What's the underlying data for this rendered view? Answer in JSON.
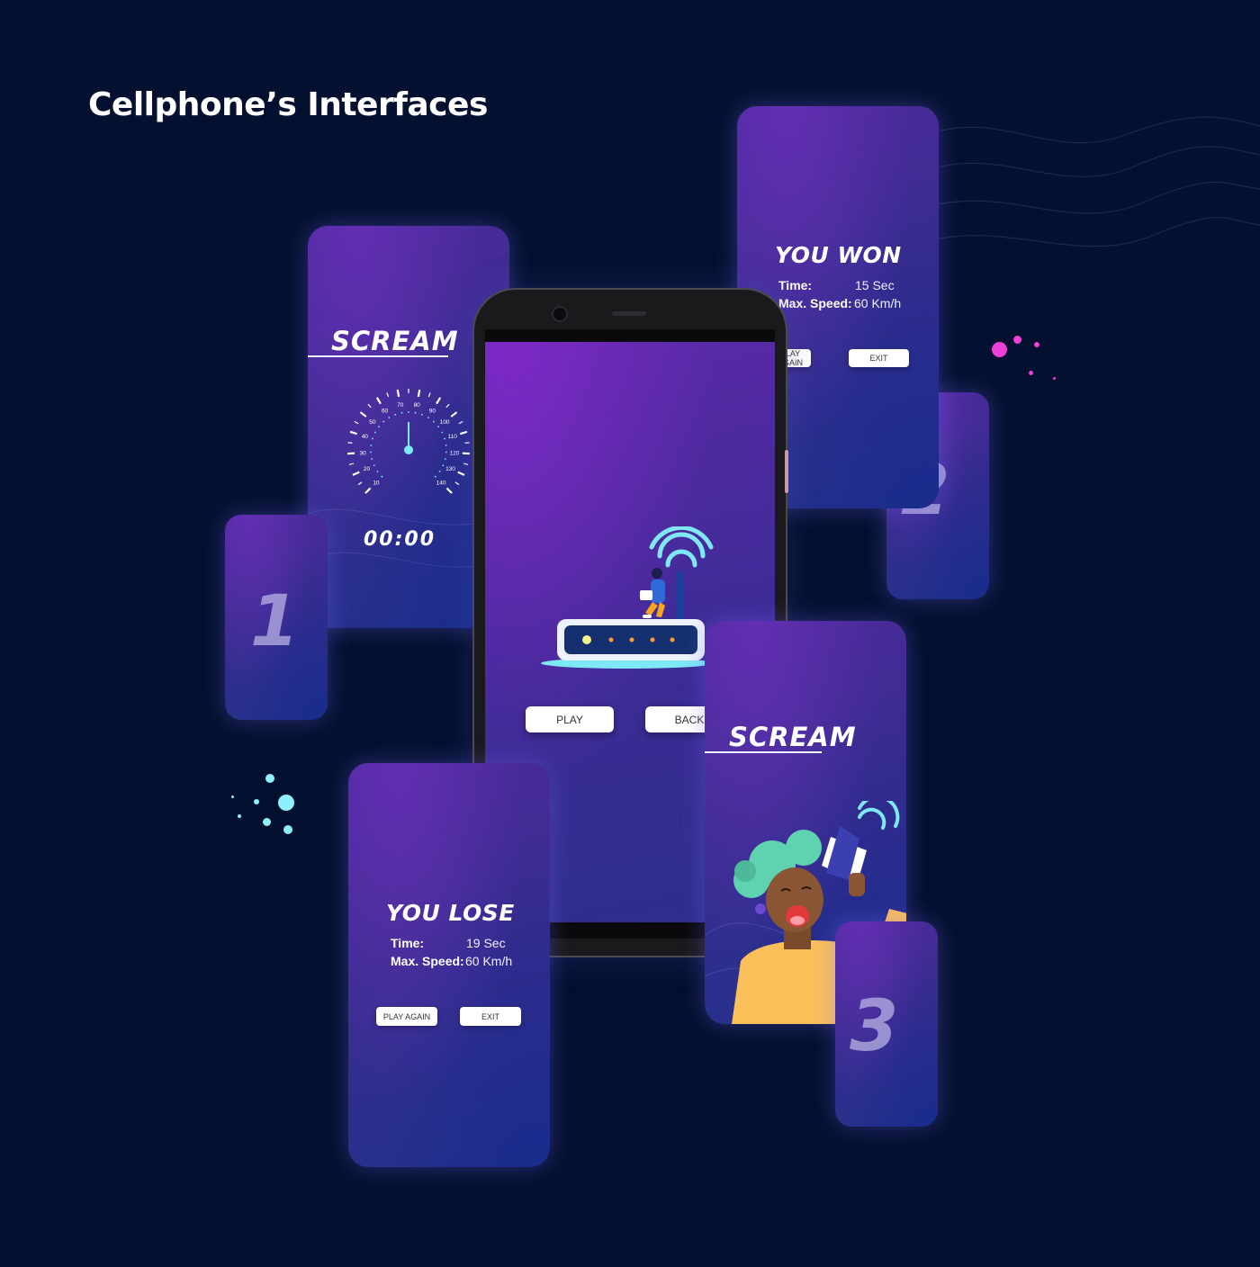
{
  "heading": "Cellphone’s Interfaces",
  "colors": {
    "background": "#04102f",
    "card_purple": "#4a2a9a",
    "card_blue": "#23318a",
    "accent_cyan": "#7ee8f6",
    "accent_pink": "#e040fb",
    "person_shirt": "#fbbf5a",
    "hair": "#5fd3b0"
  },
  "screen_splash": {
    "logo": "SCREAM",
    "speedometer_ticks": [
      "10",
      "20",
      "30",
      "40",
      "50",
      "60",
      "70",
      "80",
      "90",
      "100",
      "110",
      "120",
      "130",
      "140"
    ],
    "timer": "00:00"
  },
  "screen_home": {
    "play_label": "PLAY",
    "back_label": "BACK"
  },
  "screen_won": {
    "title": "YOU WON",
    "time_label": "Time:",
    "time_value": "15 Sec",
    "speed_label": "Max. Speed:",
    "speed_value": "60 Km/h",
    "play_again_label": "PLAY AGAIN",
    "exit_label": "EXIT"
  },
  "screen_lose": {
    "title": "YOU LOSE",
    "time_label": "Time:",
    "time_value": "19 Sec",
    "speed_label": "Max. Speed:",
    "speed_value": "60 Km/h",
    "play_again_label": "PLAY AGAIN",
    "exit_label": "EXIT"
  },
  "screen_intro": {
    "logo": "SCREAM"
  },
  "step_numbers": [
    "1",
    "2",
    "3"
  ]
}
